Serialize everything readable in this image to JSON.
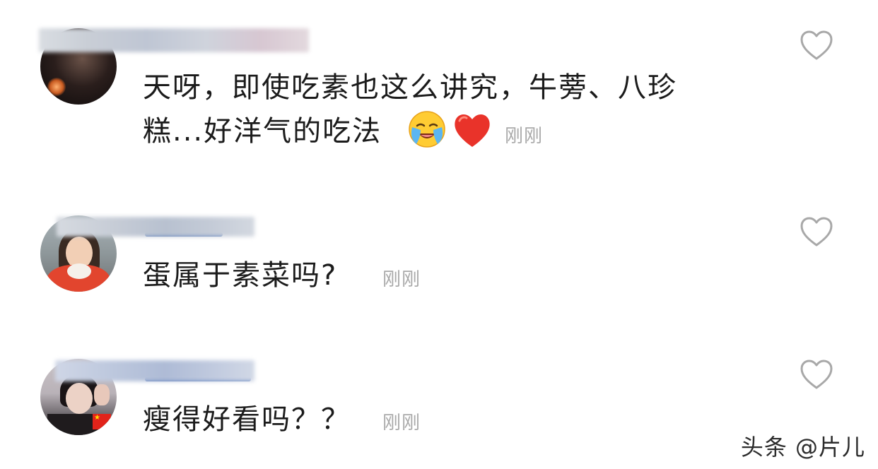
{
  "comments": [
    {
      "text_line1": "天呀，即使吃素也这么讲究，牛蒡、八珍",
      "text_line2": "糕...好洋气的吃法",
      "emojis": [
        "loudly-crying-face-emoji",
        "red-heart-emoji"
      ],
      "timestamp": "刚刚",
      "like_icon": "heart-outline-icon",
      "username_obscured": true
    },
    {
      "text": "蛋属于素菜吗?",
      "timestamp": "刚刚",
      "like_icon": "heart-outline-icon",
      "username_obscured": true
    },
    {
      "text": "瘦得好看吗？？",
      "timestamp": "刚刚",
      "like_icon": "heart-outline-icon",
      "username_obscured": true
    }
  ],
  "watermark": "头条 @片儿",
  "colors": {
    "text": "#1b1b1b",
    "timestamp": "#a9a9a9",
    "like_icon": "#a8a8a8",
    "username_link": "#3d67b3",
    "heart_emoji": "#e9332a",
    "background": "#ffffff"
  }
}
